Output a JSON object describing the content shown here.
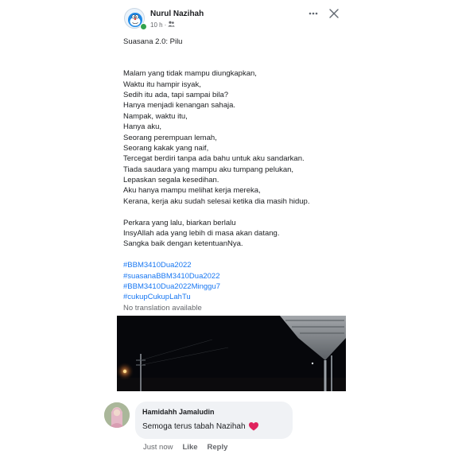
{
  "post": {
    "author": "Nurul Nazihah",
    "timestamp": "10 h",
    "separator": "·",
    "audience_icon": "friends-icon",
    "more_icon": "more-horizontal-icon",
    "close_icon": "close-icon",
    "body": {
      "title": "Suasana 2.0: Pilu",
      "stanza1": [
        "Malam yang tidak mampu diungkapkan,",
        "Waktu itu hampir isyak,",
        "Sedih itu ada, tapi sampai bila?",
        "Hanya menjadi kenangan sahaja.",
        "Nampak, waktu itu,",
        "Hanya aku,",
        "Seorang perempuan lemah,",
        "Seorang kakak yang naif,",
        "Tercegat berdiri tanpa ada bahu untuk aku sandarkan.",
        "Tiada saudara yang mampu aku tumpang pelukan,",
        "Lepaskan segala kesedihan.",
        "Aku hanya mampu melihat kerja mereka,",
        "Kerana, kerja aku sudah selesai ketika dia masih hidup."
      ],
      "stanza2": [
        "Perkara yang lalu, biarkan berlalu",
        "InsyAllah ada yang lebih di masa akan datang.",
        "Sangka baik dengan ketentuanNya."
      ],
      "hashtags": [
        "#BBM3410Dua2022",
        "#suasanaBBM3410Dua2022",
        "#BBM3410Dua2022Minggu7",
        "#cukupCukupLahTu"
      ],
      "translation_note": "No translation available"
    }
  },
  "comment": {
    "author": "Hamidahh Jamaludin",
    "text": "Semoga terus tabah Nazihah",
    "emoji_icon": "red-heart-icon",
    "time": "Just now",
    "like_label": "Like",
    "reply_label": "Reply"
  },
  "colors": {
    "link": "#1877f2",
    "secondary_text": "#65676b",
    "bubble_bg": "#f0f2f5",
    "online": "#31a24c",
    "heart": "#e0245e"
  }
}
